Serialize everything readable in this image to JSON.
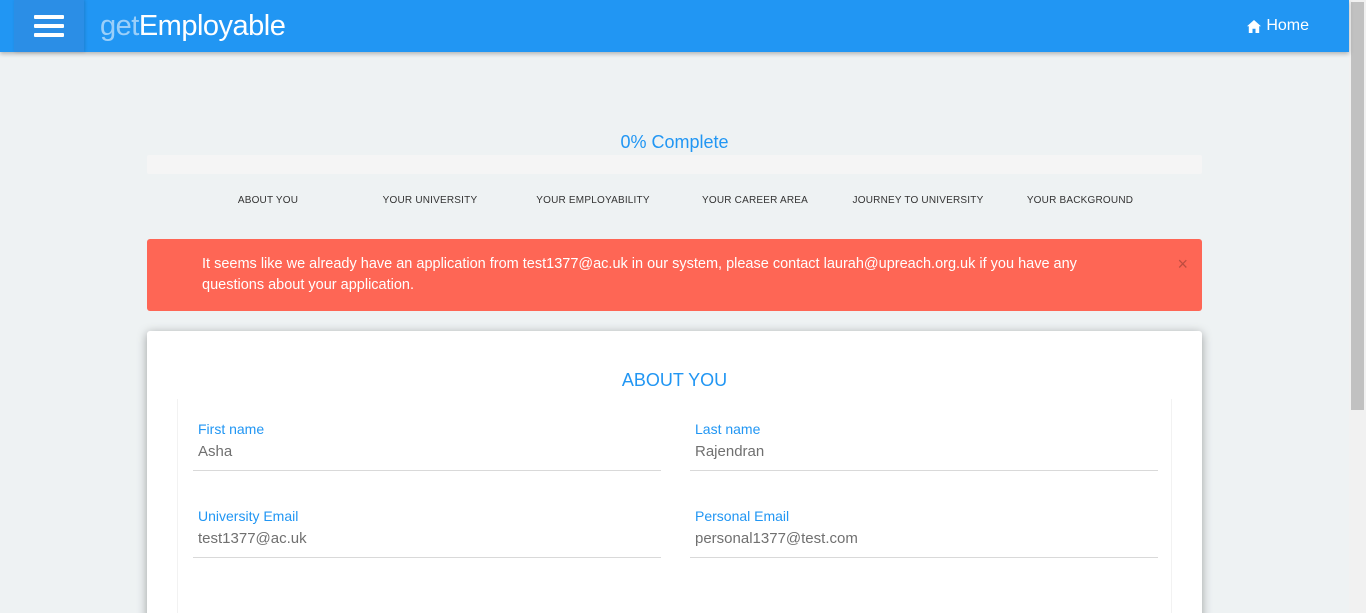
{
  "header": {
    "brand_light": "get",
    "brand_strong": "Employable",
    "home_label": "Home",
    "menu_icon": "hamburger-menu-icon",
    "home_icon": "home-icon",
    "accent_color": "#2196f3"
  },
  "progress": {
    "label": "0% Complete",
    "percent": 0
  },
  "steps": [
    "ABOUT YOU",
    "YOUR UNIVERSITY",
    "YOUR EMPLOYABILITY",
    "YOUR CAREER AREA",
    "JOURNEY TO UNIVERSITY",
    "YOUR BACKGROUND"
  ],
  "alert": {
    "message": "It seems like we already have an application from test1377@ac.uk in our system, please contact laurah@upreach.org.uk if you have any questions about your application.",
    "close": "×",
    "color": "#fe6655"
  },
  "form": {
    "title": "ABOUT YOU",
    "first_name": {
      "label": "First name",
      "value": "Asha"
    },
    "last_name": {
      "label": "Last name",
      "value": "Rajendran"
    },
    "university_email": {
      "label": "University Email",
      "value": "test1377@ac.uk"
    },
    "personal_email": {
      "label": "Personal Email",
      "value": "personal1377@test.com"
    }
  }
}
